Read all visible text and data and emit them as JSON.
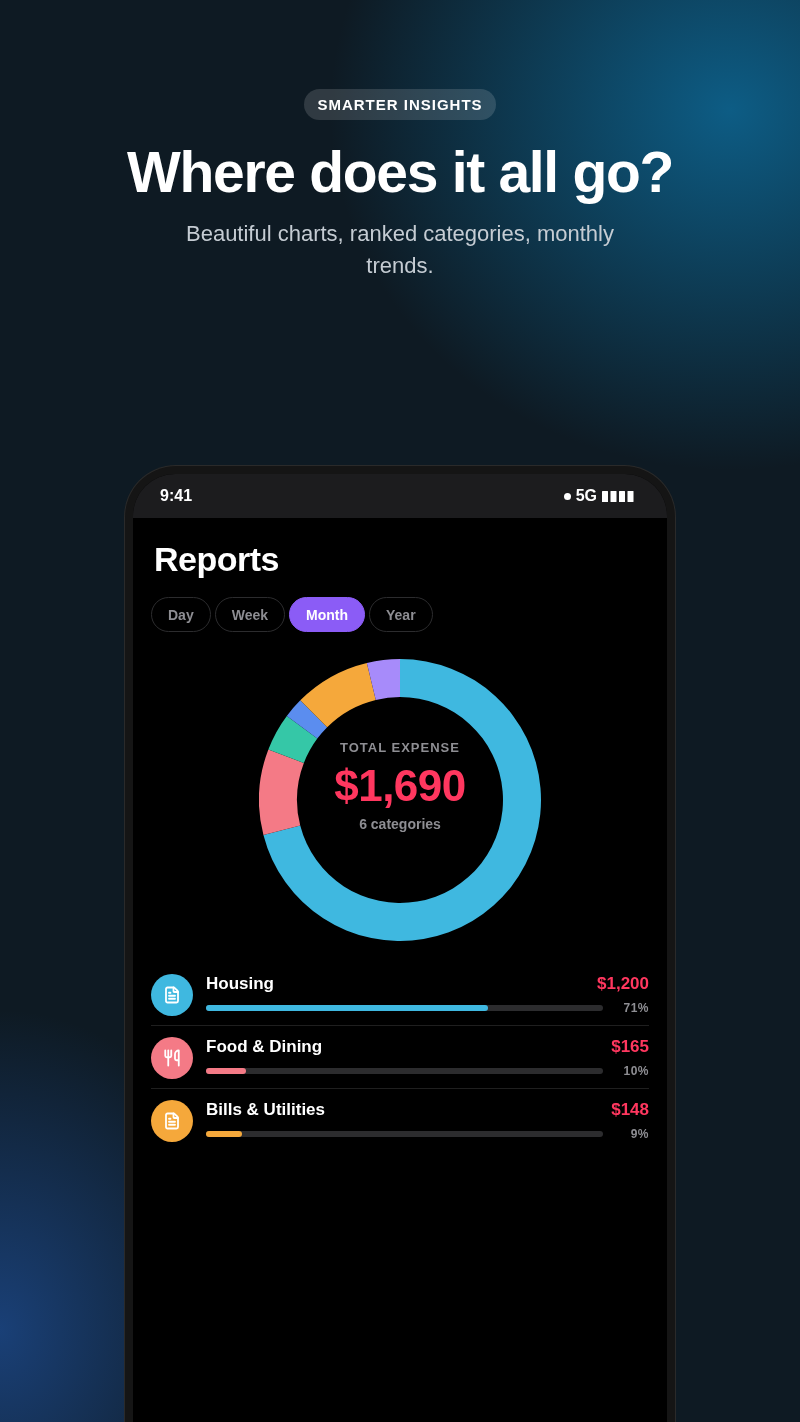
{
  "badge": "SMARTER INSIGHTS",
  "headline": "Where does it all go?",
  "subtitle": "Beautiful charts, ranked categories, monthly trends.",
  "phone": {
    "status_bar": {
      "time": "9:41",
      "network": "5G"
    },
    "title": "Reports",
    "tabs": [
      {
        "label": "Day",
        "selected": false
      },
      {
        "label": "Week",
        "selected": false
      },
      {
        "label": "Month",
        "selected": true
      },
      {
        "label": "Year",
        "selected": false
      }
    ],
    "summary": {
      "label": "TOTAL EXPENSE",
      "total": "$1,690",
      "count": "6 categories"
    },
    "categories": [
      {
        "kind": "document",
        "name": "Housing",
        "amount": "$1,200",
        "percent": "71%",
        "level": 0.71,
        "color": "#3fb8e0"
      },
      {
        "kind": "utensils",
        "name": "Food & Dining",
        "amount": "$165",
        "percent": "10%",
        "level": 0.1,
        "color": "#f47a86"
      },
      {
        "kind": "document",
        "name": "Bills & Utilities",
        "amount": "$148",
        "percent": "9%",
        "level": 0.09,
        "color": "#f5a83b"
      }
    ]
  }
}
